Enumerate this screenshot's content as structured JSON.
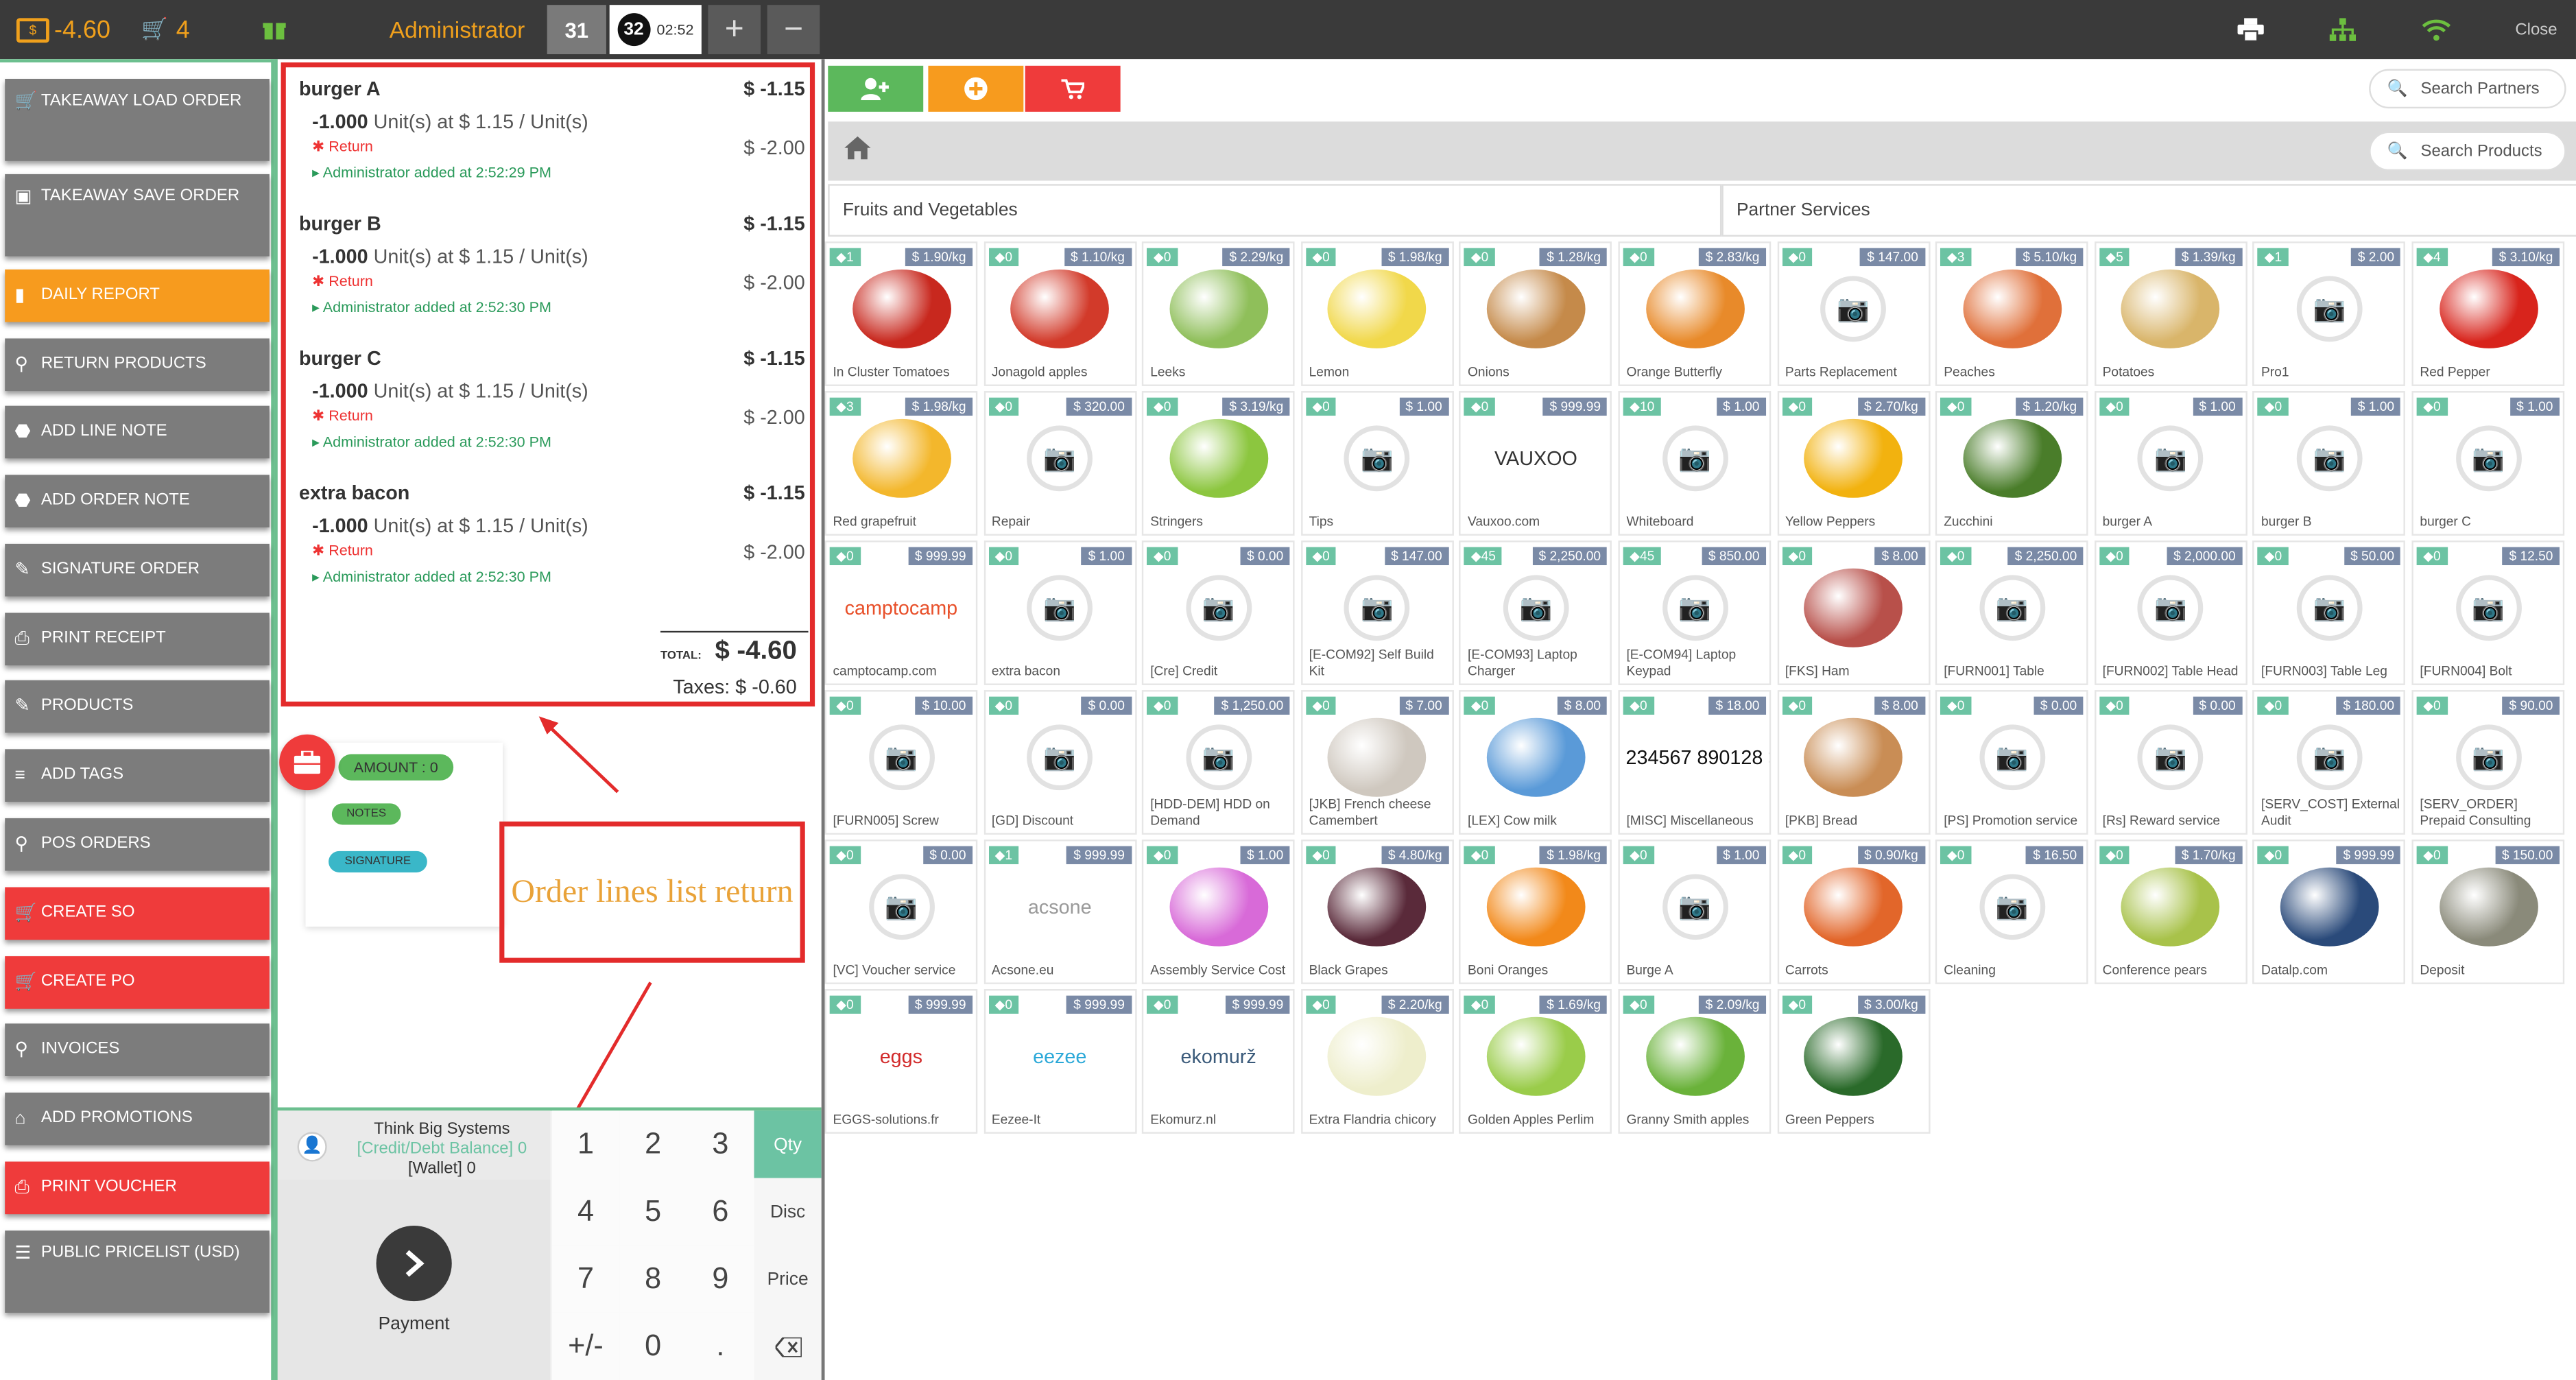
{
  "topbar": {
    "balance": "-4.60",
    "cart_count": "4",
    "user": "Administrator",
    "orders": [
      {
        "number": "31",
        "time": ""
      },
      {
        "number": "32",
        "time": "02:52"
      }
    ],
    "add_order": "+",
    "remove_order": "−",
    "close_label": "Close"
  },
  "sidebar": {
    "items": [
      {
        "label": "TAKEAWAY LOAD ORDER",
        "color": "grey",
        "icon": "cart-icon"
      },
      {
        "label": "TAKEAWAY SAVE ORDER",
        "color": "grey",
        "icon": "save-icon"
      },
      {
        "label": "DAILY REPORT",
        "color": "orange",
        "icon": "bar-chart-icon"
      },
      {
        "label": "RETURN PRODUCTS",
        "color": "grey",
        "icon": "search-icon"
      },
      {
        "label": "ADD LINE NOTE",
        "color": "grey",
        "icon": "tag-icon"
      },
      {
        "label": "ADD ORDER NOTE",
        "color": "grey",
        "icon": "tag-icon"
      },
      {
        "label": "SIGNATURE ORDER",
        "color": "grey",
        "icon": "edit-icon"
      },
      {
        "label": "PRINT RECEIPT",
        "color": "grey",
        "icon": "printer-icon"
      },
      {
        "label": "PRODUCTS",
        "color": "grey",
        "icon": "edit-icon"
      },
      {
        "label": "ADD TAGS",
        "color": "grey",
        "icon": "sliders-icon"
      },
      {
        "label": "POS ORDERS",
        "color": "grey",
        "icon": "search-icon"
      },
      {
        "label": "CREATE SO",
        "color": "red",
        "icon": "cart-icon"
      },
      {
        "label": "CREATE PO",
        "color": "red",
        "icon": "cart-icon"
      },
      {
        "label": "INVOICES",
        "color": "grey",
        "icon": "search-icon"
      },
      {
        "label": "ADD PROMOTIONS",
        "color": "grey",
        "icon": "gift-icon"
      },
      {
        "label": "PRINT VOUCHER",
        "color": "red",
        "icon": "printer-icon"
      },
      {
        "label": "PUBLIC PRICELIST (USD)",
        "color": "grey",
        "icon": "list-icon"
      }
    ]
  },
  "order": {
    "lines": [
      {
        "name": "burger A",
        "price": "$ -1.15",
        "qty": "-1.000",
        "unit_text": " Unit(s) at $ 1.15 / Unit(s)",
        "return": "Return",
        "discount": "$ -2.00",
        "added": "Administrator added at 2:52:29 PM"
      },
      {
        "name": "burger B",
        "price": "$ -1.15",
        "qty": "-1.000",
        "unit_text": " Unit(s) at $ 1.15 / Unit(s)",
        "return": "Return",
        "discount": "$ -2.00",
        "added": "Administrator added at 2:52:30 PM"
      },
      {
        "name": "burger C",
        "price": "$ -1.15",
        "qty": "-1.000",
        "unit_text": " Unit(s) at $ 1.15 / Unit(s)",
        "return": "Return",
        "discount": "$ -2.00",
        "added": "Administrator added at 2:52:30 PM"
      },
      {
        "name": "extra bacon",
        "price": "$ -1.15",
        "qty": "-1.000",
        "unit_text": " Unit(s) at $ 1.15 / Unit(s)",
        "return": "Return",
        "discount": "$ -2.00",
        "added": "Administrator added at 2:52:30 PM"
      }
    ],
    "total_label": "TOTAL:",
    "total": "$ -4.60",
    "taxes": "Taxes: $ -0.60"
  },
  "promo": {
    "amount": "AMOUNT : 0",
    "notes": "NOTES",
    "signature": "SIGNATURE"
  },
  "annotation": "Order lines list return",
  "customer": {
    "name": "Think Big Systems",
    "credit": "[Credit/Debt Balance] 0",
    "wallet": "[Wallet] 0"
  },
  "payment_label": "Payment",
  "numpad": {
    "keys": [
      "1",
      "2",
      "3",
      "4",
      "5",
      "6",
      "7",
      "8",
      "9",
      "+/-",
      "0",
      "."
    ],
    "modes": [
      "Qty",
      "Disc",
      "Price"
    ],
    "selected_mode": "Qty"
  },
  "search": {
    "partners_placeholder": "Search Partners",
    "products_placeholder": "Search Products"
  },
  "categories": [
    "Fruits and Vegetables",
    "Partner Services"
  ],
  "products": [
    {
      "name": "In Cluster Tomatoes",
      "qty": "1",
      "price": "$ 1.90/kg",
      "img": "food",
      "color": "#c8281e"
    },
    {
      "name": "Jonagold apples",
      "qty": "0",
      "price": "$ 1.10/kg",
      "img": "food",
      "color": "#d23a2a"
    },
    {
      "name": "Leeks",
      "qty": "0",
      "price": "$ 2.29/kg",
      "img": "food",
      "color": "#8fbf5a"
    },
    {
      "name": "Lemon",
      "qty": "0",
      "price": "$ 1.98/kg",
      "img": "food",
      "color": "#f1d84a"
    },
    {
      "name": "Onions",
      "qty": "0",
      "price": "$ 1.28/kg",
      "img": "food",
      "color": "#c58a4a"
    },
    {
      "name": "Orange Butterfly",
      "qty": "0",
      "price": "$ 2.83/kg",
      "img": "food",
      "color": "#e88a2a"
    },
    {
      "name": "Parts Replacement",
      "qty": "0",
      "price": "$ 147.00",
      "img": "none"
    },
    {
      "name": "Peaches",
      "qty": "3",
      "price": "$ 5.10/kg",
      "img": "food",
      "color": "#e0703a"
    },
    {
      "name": "Potatoes",
      "qty": "5",
      "price": "$ 1.39/kg",
      "img": "food",
      "color": "#d9b56a"
    },
    {
      "name": "Pro1",
      "qty": "1",
      "price": "$ 2.00",
      "img": "none"
    },
    {
      "name": "Red Pepper",
      "qty": "4",
      "price": "$ 3.10/kg",
      "img": "food",
      "color": "#d8241c"
    },
    {
      "name": "Red grapefruit",
      "qty": "3",
      "price": "$ 1.98/kg",
      "img": "food",
      "color": "#f3b72c"
    },
    {
      "name": "Repair",
      "qty": "0",
      "price": "$ 320.00",
      "img": "none"
    },
    {
      "name": "Stringers",
      "qty": "0",
      "price": "$ 3.19/kg",
      "img": "food",
      "color": "#8cc63f"
    },
    {
      "name": "Tips",
      "qty": "0",
      "price": "$ 1.00",
      "img": "none"
    },
    {
      "name": "Vauxoo.com",
      "qty": "0",
      "price": "$ 999.99",
      "img": "logo",
      "logo": "VAUXOO",
      "color": "#333333"
    },
    {
      "name": "Whiteboard",
      "qty": "10",
      "price": "$ 1.00",
      "img": "none"
    },
    {
      "name": "Yellow Peppers",
      "qty": "0",
      "price": "$ 2.70/kg",
      "img": "food",
      "color": "#f2b20f"
    },
    {
      "name": "Zucchini",
      "qty": "0",
      "price": "$ 1.20/kg",
      "img": "food",
      "color": "#4a7d2a"
    },
    {
      "name": "burger A",
      "qty": "0",
      "price": "$ 1.00",
      "img": "none"
    },
    {
      "name": "burger B",
      "qty": "0",
      "price": "$ 1.00",
      "img": "none"
    },
    {
      "name": "burger C",
      "qty": "0",
      "price": "$ 1.00",
      "img": "none"
    },
    {
      "name": "camptocamp.com",
      "qty": "0",
      "price": "$ 999.99",
      "img": "logo",
      "logo": "camptocamp",
      "color": "#e8502a"
    },
    {
      "name": "extra bacon",
      "qty": "0",
      "price": "$ 1.00",
      "img": "none"
    },
    {
      "name": "[Cre] Credit",
      "qty": "0",
      "price": "$ 0.00",
      "img": "none"
    },
    {
      "name": "[E-COM92] Self Build Kit",
      "qty": "0",
      "price": "$ 147.00",
      "img": "none"
    },
    {
      "name": "[E-COM93] Laptop Charger",
      "qty": "45",
      "price": "$ 2,250.00",
      "img": "none"
    },
    {
      "name": "[E-COM94] Laptop Keypad",
      "qty": "45",
      "price": "$ 850.00",
      "img": "none"
    },
    {
      "name": "[FKS] Ham",
      "qty": "0",
      "price": "$ 8.00",
      "img": "food",
      "color": "#b8504a"
    },
    {
      "name": "[FURN001] Table",
      "qty": "0",
      "price": "$ 2,250.00",
      "img": "none"
    },
    {
      "name": "[FURN002] Table Head",
      "qty": "0",
      "price": "$ 2,000.00",
      "img": "none"
    },
    {
      "name": "[FURN003] Table Leg",
      "qty": "0",
      "price": "$ 50.00",
      "img": "none"
    },
    {
      "name": "[FURN004] Bolt",
      "qty": "0",
      "price": "$ 12.50",
      "img": "none"
    },
    {
      "name": "[FURN005] Screw",
      "qty": "0",
      "price": "$ 10.00",
      "img": "none"
    },
    {
      "name": "[GD] Discount",
      "qty": "0",
      "price": "$ 0.00",
      "img": "none"
    },
    {
      "name": "[HDD-DEM] HDD on Demand",
      "qty": "0",
      "price": "$ 1,250.00",
      "img": "none"
    },
    {
      "name": "[JKB] French cheese Camembert",
      "qty": "0",
      "price": "$ 7.00",
      "img": "food",
      "color": "#cfc8bf"
    },
    {
      "name": "[LEX] Cow milk",
      "qty": "0",
      "price": "$ 8.00",
      "img": "food",
      "color": "#5a9ad8"
    },
    {
      "name": "[MISC] Miscellaneous",
      "qty": "0",
      "price": "$ 18.00",
      "img": "logo",
      "logo": "1 234567 890128 >",
      "color": "#111111"
    },
    {
      "name": "[PKB] Bread",
      "qty": "0",
      "price": "$ 8.00",
      "img": "food",
      "color": "#c98d55"
    },
    {
      "name": "[PS] Promotion service",
      "qty": "0",
      "price": "$ 0.00",
      "img": "none"
    },
    {
      "name": "[Rs] Reward service",
      "qty": "0",
      "price": "$ 0.00",
      "img": "none"
    },
    {
      "name": "[SERV_COST] External Audit",
      "qty": "0",
      "price": "$ 180.00",
      "img": "none"
    },
    {
      "name": "[SERV_ORDER] Prepaid Consulting",
      "qty": "0",
      "price": "$ 90.00",
      "img": "none"
    },
    {
      "name": "[VC] Voucher service",
      "qty": "0",
      "price": "$ 0.00",
      "img": "none"
    },
    {
      "name": "Acsone.eu",
      "qty": "1",
      "price": "$ 999.99",
      "img": "logo",
      "logo": "acsone",
      "color": "#9a9a9a"
    },
    {
      "name": "Assembly Service Cost",
      "qty": "0",
      "price": "$ 1.00",
      "img": "food",
      "color": "#d86ad8"
    },
    {
      "name": "Black Grapes",
      "qty": "0",
      "price": "$ 4.80/kg",
      "img": "food",
      "color": "#5a2a3a"
    },
    {
      "name": "Boni Oranges",
      "qty": "0",
      "price": "$ 1.98/kg",
      "img": "food",
      "color": "#f2891a"
    },
    {
      "name": "Burge A",
      "qty": "0",
      "price": "$ 1.00",
      "img": "none"
    },
    {
      "name": "Carrots",
      "qty": "0",
      "price": "$ 0.90/kg",
      "img": "food",
      "color": "#e2662a"
    },
    {
      "name": "Cleaning",
      "qty": "0",
      "price": "$ 16.50",
      "img": "none"
    },
    {
      "name": "Conference pears",
      "qty": "0",
      "price": "$ 1.70/kg",
      "img": "food",
      "color": "#a8c24a"
    },
    {
      "name": "Datalp.com",
      "qty": "0",
      "price": "$ 999.99",
      "img": "food",
      "color": "#2a4a7a"
    },
    {
      "name": "Deposit",
      "qty": "0",
      "price": "$ 150.00",
      "img": "food",
      "color": "#8a8a7a"
    },
    {
      "name": "EGGS-solutions.fr",
      "qty": "0",
      "price": "$ 999.99",
      "img": "logo",
      "logo": "eggs",
      "color": "#d22a2a"
    },
    {
      "name": "Eezee-It",
      "qty": "0",
      "price": "$ 999.99",
      "img": "logo",
      "logo": "eezee",
      "color": "#2aa8d8"
    },
    {
      "name": "Ekomurz.nl",
      "qty": "0",
      "price": "$ 999.99",
      "img": "logo",
      "logo": "ekomurž",
      "color": "#3a5a7a"
    },
    {
      "name": "Extra Flandria chicory",
      "qty": "0",
      "price": "$ 2.20/kg",
      "img": "food",
      "color": "#eeeecc"
    },
    {
      "name": "Golden Apples Perlim",
      "qty": "0",
      "price": "$ 1.69/kg",
      "img": "food",
      "color": "#9acc4a"
    },
    {
      "name": "Granny Smith apples",
      "qty": "0",
      "price": "$ 2.09/kg",
      "img": "food",
      "color": "#6ab23a"
    },
    {
      "name": "Green Peppers",
      "qty": "0",
      "price": "$ 3.00/kg",
      "img": "food",
      "color": "#2a6a2a"
    }
  ]
}
